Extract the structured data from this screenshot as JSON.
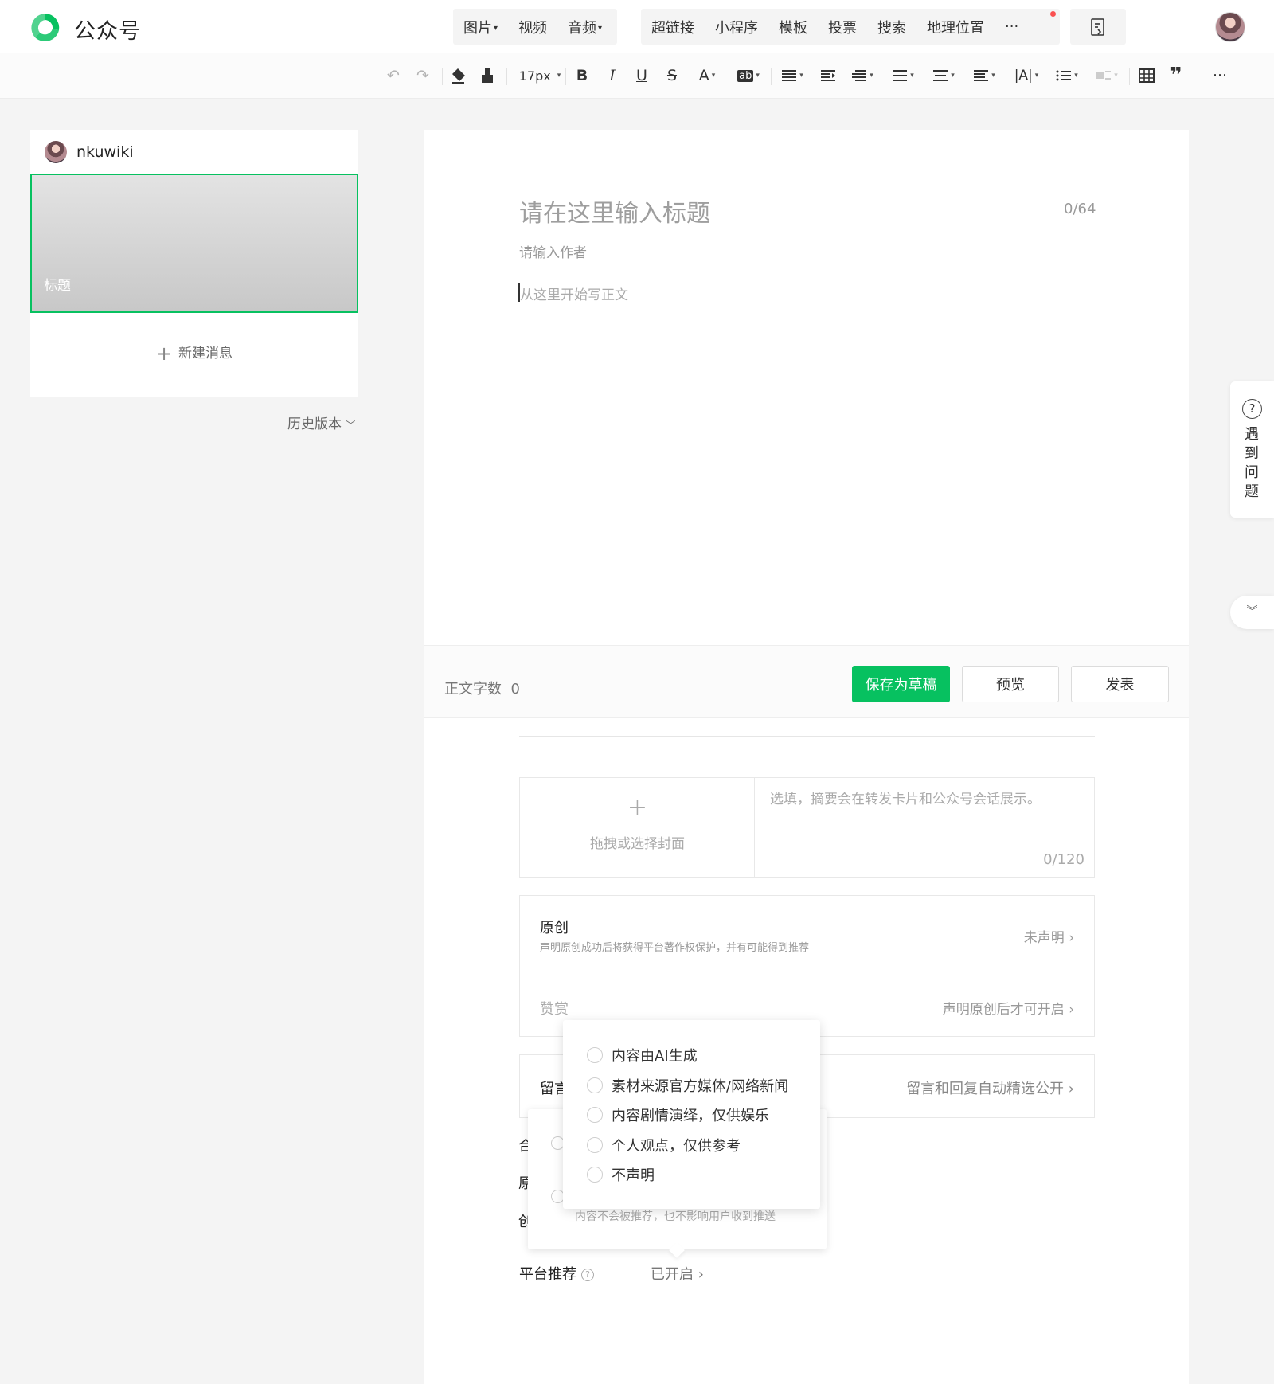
{
  "header": {
    "brand": "公众号",
    "insert_group1": [
      {
        "label": "图片",
        "caret": "▾"
      },
      {
        "label": "视频",
        "caret": ""
      },
      {
        "label": "音频",
        "caret": "▾"
      }
    ],
    "insert_group2": [
      {
        "label": "超链接"
      },
      {
        "label": "小程序"
      },
      {
        "label": "模板"
      },
      {
        "label": "投票"
      },
      {
        "label": "搜索"
      },
      {
        "label": "地理位置"
      },
      {
        "label": "···"
      }
    ]
  },
  "toolbar": {
    "undo": "↶",
    "redo": "↷",
    "font_size": "17px",
    "bold": "B",
    "italic": "I",
    "underline": "U",
    "strike": "S",
    "font_color": "A",
    "bg_color": "ab",
    "more": "···"
  },
  "left_panel": {
    "account_name": "nkuwiki",
    "cover_title": "标题",
    "new_message": "新建消息",
    "history": "历史版本"
  },
  "editor": {
    "title_placeholder": "请在这里输入标题",
    "title_count": "0/64",
    "author_placeholder": "请输入作者",
    "body_placeholder": "从这里开始写正文",
    "word_count_label": "正文字数",
    "word_count": "0",
    "save_draft": "保存为草稿",
    "preview": "预览",
    "publish": "发表",
    "cover_add": "拖拽或选择封面",
    "summary_placeholder": "选填，摘要会在转发卡片和公众号会话展示。",
    "summary_count": "0/120",
    "original_title": "原创",
    "original_desc": "声明原创成功后将获得平台著作权保护，并有可能得到推荐",
    "original_state": "未声明",
    "reward_label": "赞赏",
    "reward_state": "声明原创后才可开启",
    "comment_label": "留言",
    "comment_state": "留言和回复自动精选公开",
    "row_he": "合",
    "row_yuan": "原",
    "row_chuang": "创",
    "recommend_label": "平台推荐",
    "recommend_state": "已开启",
    "tooltip_text": "内容不会被推荐，也不影响用户收到推送"
  },
  "creation_source_dropdown": {
    "options": [
      "内容由AI生成",
      "素材来源官方媒体/网络新闻",
      "内容剧情演绎，仅供娱乐",
      "个人观点，仅供参考",
      "不声明"
    ]
  },
  "side_help": {
    "label": "遇到问题",
    "icon": "?"
  },
  "colors": {
    "accent": "#07c160",
    "notification_dot": "#fa5151"
  }
}
